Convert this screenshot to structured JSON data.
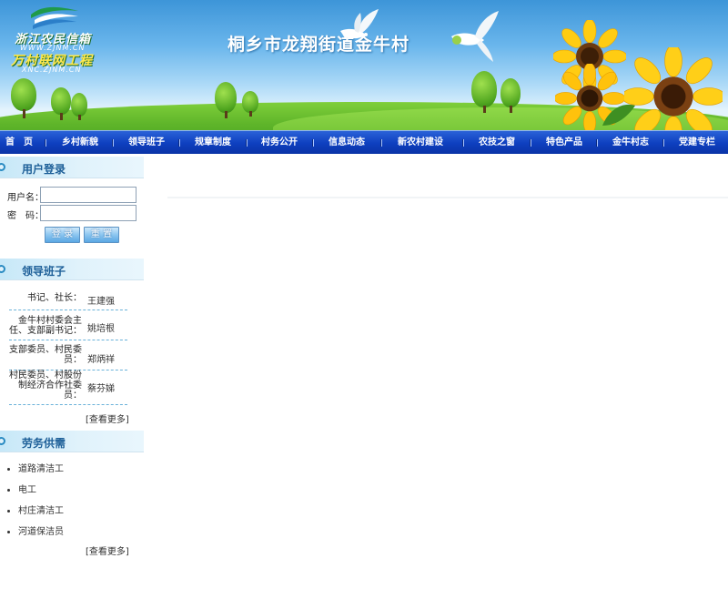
{
  "logo": {
    "line1": "浙江农民信箱",
    "line2": "WWW.ZJNM.CN",
    "line3": "万村联网工程",
    "line4": "XNC.ZJNM.CN"
  },
  "site_title": "桐乡市龙翔街道金牛村",
  "nav": [
    "首　页",
    "乡村新貌",
    "领导班子",
    "规章制度",
    "村务公开",
    "信息动态",
    "新农村建设",
    "农技之窗",
    "特色产品",
    "金牛村志",
    "党建专栏"
  ],
  "login": {
    "title": "用户登录",
    "username_label": "用户名：",
    "password_label": "密　码：",
    "username_value": "",
    "password_value": "",
    "login_button": "登 录",
    "reset_button": "重 置"
  },
  "leaders": {
    "title": "领导班子",
    "rows": [
      {
        "role": "书记、社长：",
        "name": "王建强"
      },
      {
        "role": "金牛村村委会主任、支部副书记：",
        "name": "姚培根"
      },
      {
        "role": "支部委员、村民委员：",
        "name": "郑炳祥"
      },
      {
        "role": "村民委员、村股份制经济合作社委员：",
        "name": "蔡芬娣"
      }
    ],
    "more": "[查看更多]"
  },
  "labor": {
    "title": "劳务供需",
    "items": [
      "道路清洁工",
      "电工",
      "村庄清洁工",
      "河道保洁员"
    ],
    "more": "[查看更多]"
  },
  "colors": {
    "nav_bg": "#0e3fbf",
    "panel_title": "#1d5f98",
    "panel_bg": "#e0f2fb",
    "sky": "#6ab6ec",
    "grass": "#5fb52a"
  }
}
